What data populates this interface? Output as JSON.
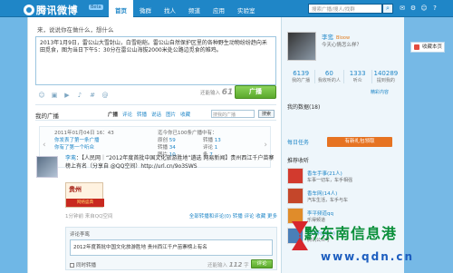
{
  "topbar": {
    "logo_text": "腾讯微博",
    "beta": "Beta",
    "nav": [
      "首页",
      "微群",
      "找人",
      "频道",
      "应用",
      "实验室"
    ],
    "search_placeholder": "搜索广播/搜人/找群"
  },
  "composer": {
    "prompt": "来，说说你在做什么，想什么",
    "text": "2013年1月9日，雷公山大雪封山，白雪皑皑。雷公山自然保护区里的各种野生动物纷纷趋向禾田觅食，图为当日下午5：30分在雷公山海拔2000米处公路边觅食的雉鸡。",
    "counter_label": "还能输入",
    "counter_value": "61",
    "counter_unit": "字",
    "post_label": "广播"
  },
  "timeline": {
    "title": "我的广播",
    "tabs": [
      "广播",
      "评论",
      "转播",
      "说话",
      "图片",
      "收藏"
    ],
    "search_placeholder": "搜我的广播",
    "search_button": "搜索"
  },
  "stats": {
    "date": "2011年01月04日 16：43",
    "line1": "你发表了第一条广播",
    "line2": "你有了第一个听众",
    "summary": "迄今你已100条广播中有：",
    "col1": [
      [
        "原创",
        "59"
      ],
      [
        "转播",
        "34"
      ],
      [
        "图片",
        "10"
      ]
    ],
    "col2": [
      [
        "转播",
        "13"
      ],
      [
        "评论",
        "1"
      ],
      [
        "条",
        "7"
      ]
    ]
  },
  "post": {
    "name": "李鸾",
    "text": "【人民网｜“2012年度首批中国文化旅游胜地”遴选 网易新闻】贵州西江千户苗寨榜上有名（分享自 @QQ空间）http://url.cn/9o3SWS",
    "img_text": "贵州",
    "img_ribbon": "网络盛典",
    "meta": "1分钟前 来自QQ空间",
    "actions": "全部转播和评论(0)  转播  评论  收藏  更多"
  },
  "reply": {
    "label": "评论李鸾",
    "text": "2012年度首批中国文化旅游胜地 贵州西江千户苗寨榜上有名",
    "option": "同时转播",
    "counter_label": "还能输入",
    "counter_value": "112",
    "counter_unit": "字",
    "button": "评论"
  },
  "profile": {
    "name": "李鸾",
    "badge": "Bloow",
    "mood": "今天心情怎么样？",
    "stats": [
      {
        "value": "6139",
        "label": "我的广播"
      },
      {
        "value": "60",
        "label": "我收听的人"
      },
      {
        "value": "1333",
        "label": "听众"
      },
      {
        "value": "140289",
        "label": "提到我的"
      }
    ],
    "more": "精彩内容"
  },
  "side": {
    "my_data": "我的数据",
    "my_data_count": "(18)",
    "daily_task": "每日任务",
    "task_button": "有新礼包领取",
    "recommend": "推荐收听",
    "rec_items": [
      {
        "title": "香车手事(21人)",
        "desc": "车事一切车，车手相强"
      },
      {
        "title": "香车网(14人)",
        "desc": "汽车生活，车手与车"
      },
      {
        "title": "李平频道qq",
        "desc": "乐得频道"
      },
      {
        "title": "QQ杯(95人)",
        "desc": "腾讯公众号"
      }
    ]
  },
  "float_button": "收藏本页",
  "watermark": {
    "line1": "黔东南信息港",
    "url": "www.qdn.cn"
  }
}
